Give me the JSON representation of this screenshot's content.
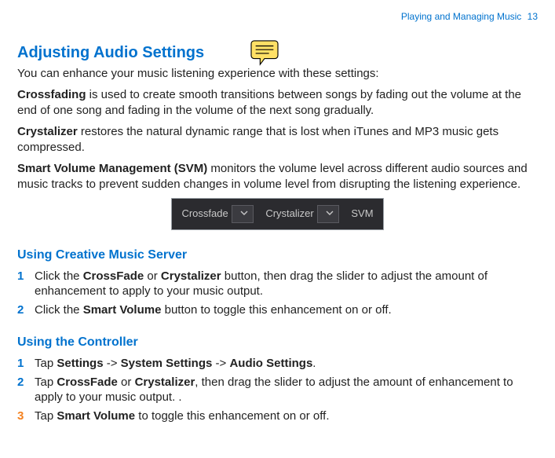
{
  "header": {
    "section": "Playing and Managing Music",
    "page_number": "13"
  },
  "title": "Adjusting Audio Settings",
  "intro": "You can enhance your music listening experience with these settings:",
  "features": [
    {
      "term": "Crossfading",
      "desc": " is used to create smooth transitions between songs by fading out the volume at the end of one song and fading in the volume of the next song gradually."
    },
    {
      "term": "Crystalizer",
      "desc": " restores the natural dynamic range that is lost when iTunes and MP3 music gets compressed."
    },
    {
      "term": "Smart Volume Management (SVM)",
      "desc": " monitors the volume level across different audio sources and music tracks to prevent sudden changes in volume level from disrupting the listening experience."
    }
  ],
  "toolbar": {
    "crossfade": "Crossfade",
    "crystalizer": "Crystalizer",
    "svm": "SVM"
  },
  "server_heading": "Using Creative Music Server",
  "server_steps": [
    {
      "pre": "Click the ",
      "b1": "CrossFade",
      "mid1": " or ",
      "b2": "Crystalizer",
      "post": " button, then drag the slider to adjust the amount of enhancement to apply to your music output."
    },
    {
      "pre": "Click the ",
      "b1": "Smart Volume",
      "post": " button to toggle this enhancement on or off."
    }
  ],
  "controller_heading": "Using the Controller",
  "controller_steps": [
    {
      "pre": "Tap ",
      "b1": "Settings",
      "mid1": " -> ",
      "b2": "System Settings",
      "mid2": " -> ",
      "b3": "Audio Settings",
      "post": "."
    },
    {
      "pre": "Tap  ",
      "b1": "CrossFade",
      "mid1": " or ",
      "b2": "Crystalizer",
      "post": ", then drag the slider to adjust the amount of enhancement to apply to your music output. ."
    },
    {
      "pre": "Tap ",
      "b1": "Smart Volume",
      "post": " to toggle this enhancement on or off."
    }
  ]
}
